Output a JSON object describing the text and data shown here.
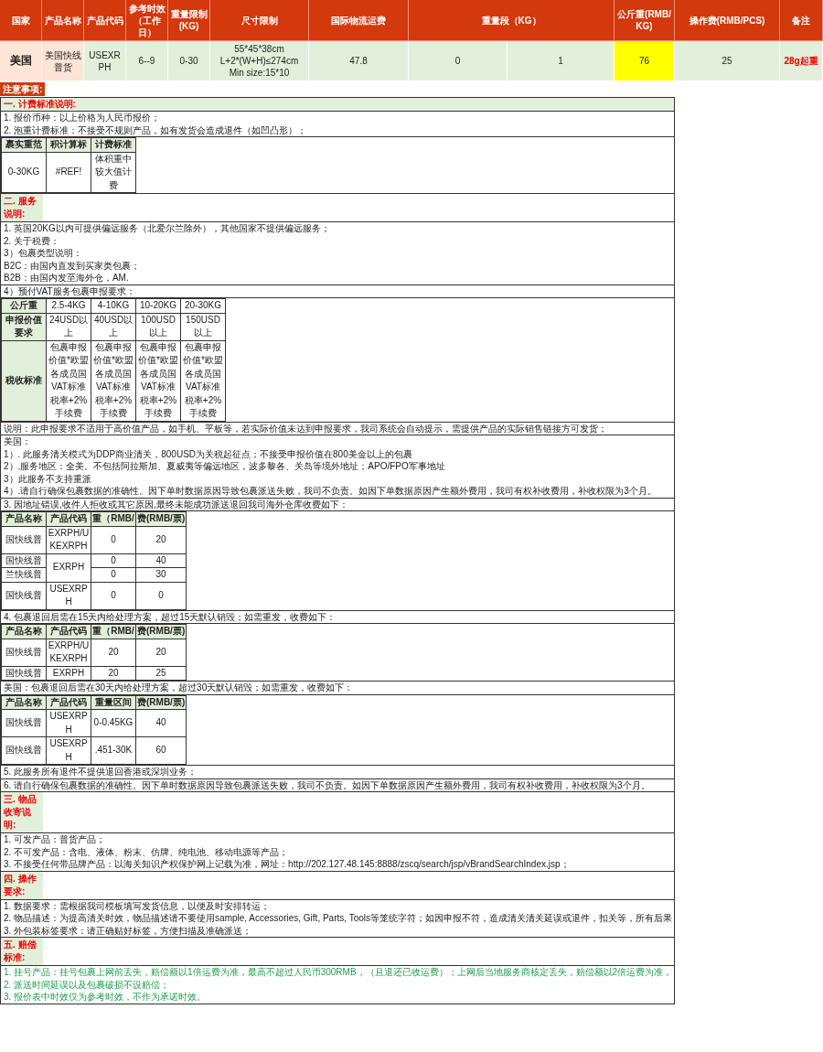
{
  "price_table": {
    "columns": [
      "国家",
      "产品名称",
      "产品代码",
      "参考时效（工作日）",
      "重量限制(KG)",
      "尺寸限制",
      "国际物流运费",
      "重量段（KG）",
      "公斤重(RMB/KG)",
      "操作费(RMB/PCS)",
      "备注"
    ],
    "row": [
      {
        "text": "美国",
        "color": "#fce4d6"
      },
      {
        "text": "美国快线普货",
        "color": "#fce4d6"
      },
      {
        "text": "USEXRPH",
        "color": "#e2efda"
      },
      {
        "text": "6--9",
        "color": "#e2efda"
      },
      {
        "text": "0-30",
        "color": "#e2efda"
      },
      {
        "text": "55*45*38cm\nL+2*(W+H)≤274cm\nMin size:15*10",
        "color": "#e2efda"
      },
      {
        "text": "47.8",
        "color": "#e2efda"
      },
      {
        "text": "0",
        "color": "#e2efda"
      },
      {
        "text": "1",
        "color": "#e2efda"
      },
      {
        "text": "76",
        "color": "#ffff00"
      },
      {
        "text": "25",
        "color": "#e2efda"
      },
      {
        "text": "28g起重",
        "color": "#e2efda"
      }
    ]
  },
  "notes": {
    "title": "注意事项:",
    "blocks": [
      {
        "kind": "band",
        "text": "一. 计费标准说明:"
      },
      {
        "kind": "lines",
        "lines": [
          "1. 报价币种：以上价格为人民币报价；",
          "2. 泡重计费标准：不接受不规则产品，如有发货会造成退件（如凹凸形）；"
        ]
      },
      {
        "kind": "table",
        "header": [
          "裹实重范",
          "积计算标",
          "计费标准"
        ],
        "rows": [
          [
            "0-30KG",
            "#REF!",
            "体积重中较大值计费"
          ]
        ]
      },
      {
        "kind": "heading",
        "text": "二. 服务说明:"
      },
      {
        "kind": "lines",
        "lines": [
          "1. 英国20KG以内可提供偏远服务（北爱尔兰除外），其他国家不提供偏远服务；",
          "2. 关于税费：",
          "3）包裹类型说明：",
          "B2C：由国内直发到买家类包裹；",
          "B2B：由国内发至海外仓，AM."
        ]
      },
      {
        "kind": "lines",
        "lines": [
          "4）预付VAT服务包裹申报要求："
        ]
      },
      {
        "kind": "matrix",
        "header": [
          "公斤重",
          "2.5-4KG",
          "4-10KG",
          "10-20KG",
          "20-30KG"
        ],
        "rows": [
          [
            "申报价值要求",
            "24USD以上",
            "40USD以上",
            "100USD以上",
            "150USD以上"
          ],
          [
            "税收标准",
            "包裹申报价值*欧盟各成员国VAT标准税率+2%手续费",
            "包裹申报价值*欧盟各成员国VAT标准税率+2%手续费",
            "包裹申报价值*欧盟各成员国VAT标准税率+2%手续费",
            "包裹申报价值*欧盟各成员国VAT标准税率+2%手续费"
          ]
        ]
      },
      {
        "kind": "lines",
        "lines": [
          "说明：此申报要求不适用于高价值产品，如手机、平板等，若实际价值未达到申报要求，我司系统会自动提示，需提供产品的实际销售链接方可发货；"
        ]
      },
      {
        "kind": "lines",
        "lines": [
          "美国：",
          "1）. 此服务清关模式为DDP商业清关，800USD为关税起征点；不接受申报价值在800美金以上的包裹",
          "2）.服务地区：全美。不包括阿拉斯加、夏威夷等偏远地区，波多黎各、关岛等境外地址；APO/FPO军事地址",
          "3）此服务不支持重派",
          "4）.请自行确保包裹数据的准确性。因下单时数据原因导致包裹派送失败，我司不负责。如因下单数据原因产生额外费用，我司有权补收费用，补收权限为3个月。"
        ]
      },
      {
        "kind": "lines",
        "lines": [
          "3. 因地址错误,收件人拒收或其它原因,最终未能成功派送退回我司海外仓库收费如下："
        ]
      },
      {
        "kind": "table",
        "header": [
          "产品名称",
          "产品代码",
          "重（RMB/",
          "费(RMB/票)"
        ],
        "rows": [
          [
            "国快线普",
            "EXRPH/UKEXRPH",
            "0",
            "20"
          ],
          [
            "国快线普",
            {
              "text": "EXRPH",
              "rowspan": 2
            },
            "0",
            "40"
          ],
          [
            "兰快线普",
            "0",
            "30"
          ],
          [
            "国快线普",
            "USEXRPH",
            "0",
            "0"
          ]
        ]
      },
      {
        "kind": "lines",
        "lines": [
          "4. 包裹退回后需在15天内给处理方案，超过15天默认销毁；如需重发，收费如下："
        ]
      },
      {
        "kind": "table",
        "header": [
          "产品名称",
          "产品代码",
          "重（RMB/",
          "费(RMB/票)"
        ],
        "rows": [
          [
            "国快线普",
            "EXRPH/UKEXRPH",
            "20",
            "20"
          ],
          [
            "国快线普",
            "EXRPH",
            "20",
            "25"
          ]
        ]
      },
      {
        "kind": "lines",
        "lines": [
          "美国：包裹退回后需在30天内给处理方案，超过30天默认销毁；如需重发，收费如下："
        ]
      },
      {
        "kind": "table",
        "header": [
          "产品名称",
          "产品代码",
          "重量区间",
          "费(RMB/票)"
        ],
        "rows": [
          [
            "国快线普",
            "USEXRPH",
            "0-0.45KG",
            "40"
          ],
          [
            "国快线普",
            "USEXRPH",
            ".451-30K",
            "60"
          ]
        ]
      },
      {
        "kind": "lines",
        "lines": [
          "5. 此服务所有退件不提供退回香港或深圳业务；"
        ]
      },
      {
        "kind": "lines",
        "lines": [
          "6. 请自行确保包裹数据的准确性。因下单时数据原因导致包裹派送失败，我司不负责。如因下单数据原因产生额外费用，我司有权补收费用，补收权限为3个月。"
        ]
      },
      {
        "kind": "heading",
        "text": "三. 物品收寄说明:"
      },
      {
        "kind": "lines",
        "lines": [
          "1. 可发产品：普货产品；",
          "2. 不可发产品：含电、液体、粉末、仿牌、纯电池、移动电源等产品；",
          "3. 不接受任何带品牌产品：以海关知识产权保护网上记载为准，网址：http://202.127.48.145:8888/zscq/search/jsp/vBrandSearchIndex.jsp；"
        ]
      },
      {
        "kind": "heading",
        "text": "四. 操作要求:"
      },
      {
        "kind": "lines",
        "lines": [
          "1. 数据要求：需根据我司模板填写发货信息，以便及时安排转运；",
          "2. 物品描述：为提高清关时效，物品描述请不要使用sample, Accessories, Gift, Parts, Tools等笼统字符；如因申报不符，造成清关清关延误或退件，扣关等，所有后果",
          "3. 外包装标签要求：请正确贴好标签，方便扫描及准确派送；"
        ]
      },
      {
        "kind": "heading",
        "text": "五. 赔偿标准:"
      },
      {
        "kind": "highlight",
        "lines": [
          "1. 挂号产品：挂号包裹上网前丢失，赔偿额以1倍运费为准，最高不超过人民币300RMB，（且退还已收运费）；上网后当地服务商核定丢失，赔偿额以2倍运费为准，",
          "2. 派送时间延误以及包裹破损不设赔偿；",
          "3. 报价表中时效仅为参考时效，不作为承诺时效。"
        ]
      }
    ]
  }
}
